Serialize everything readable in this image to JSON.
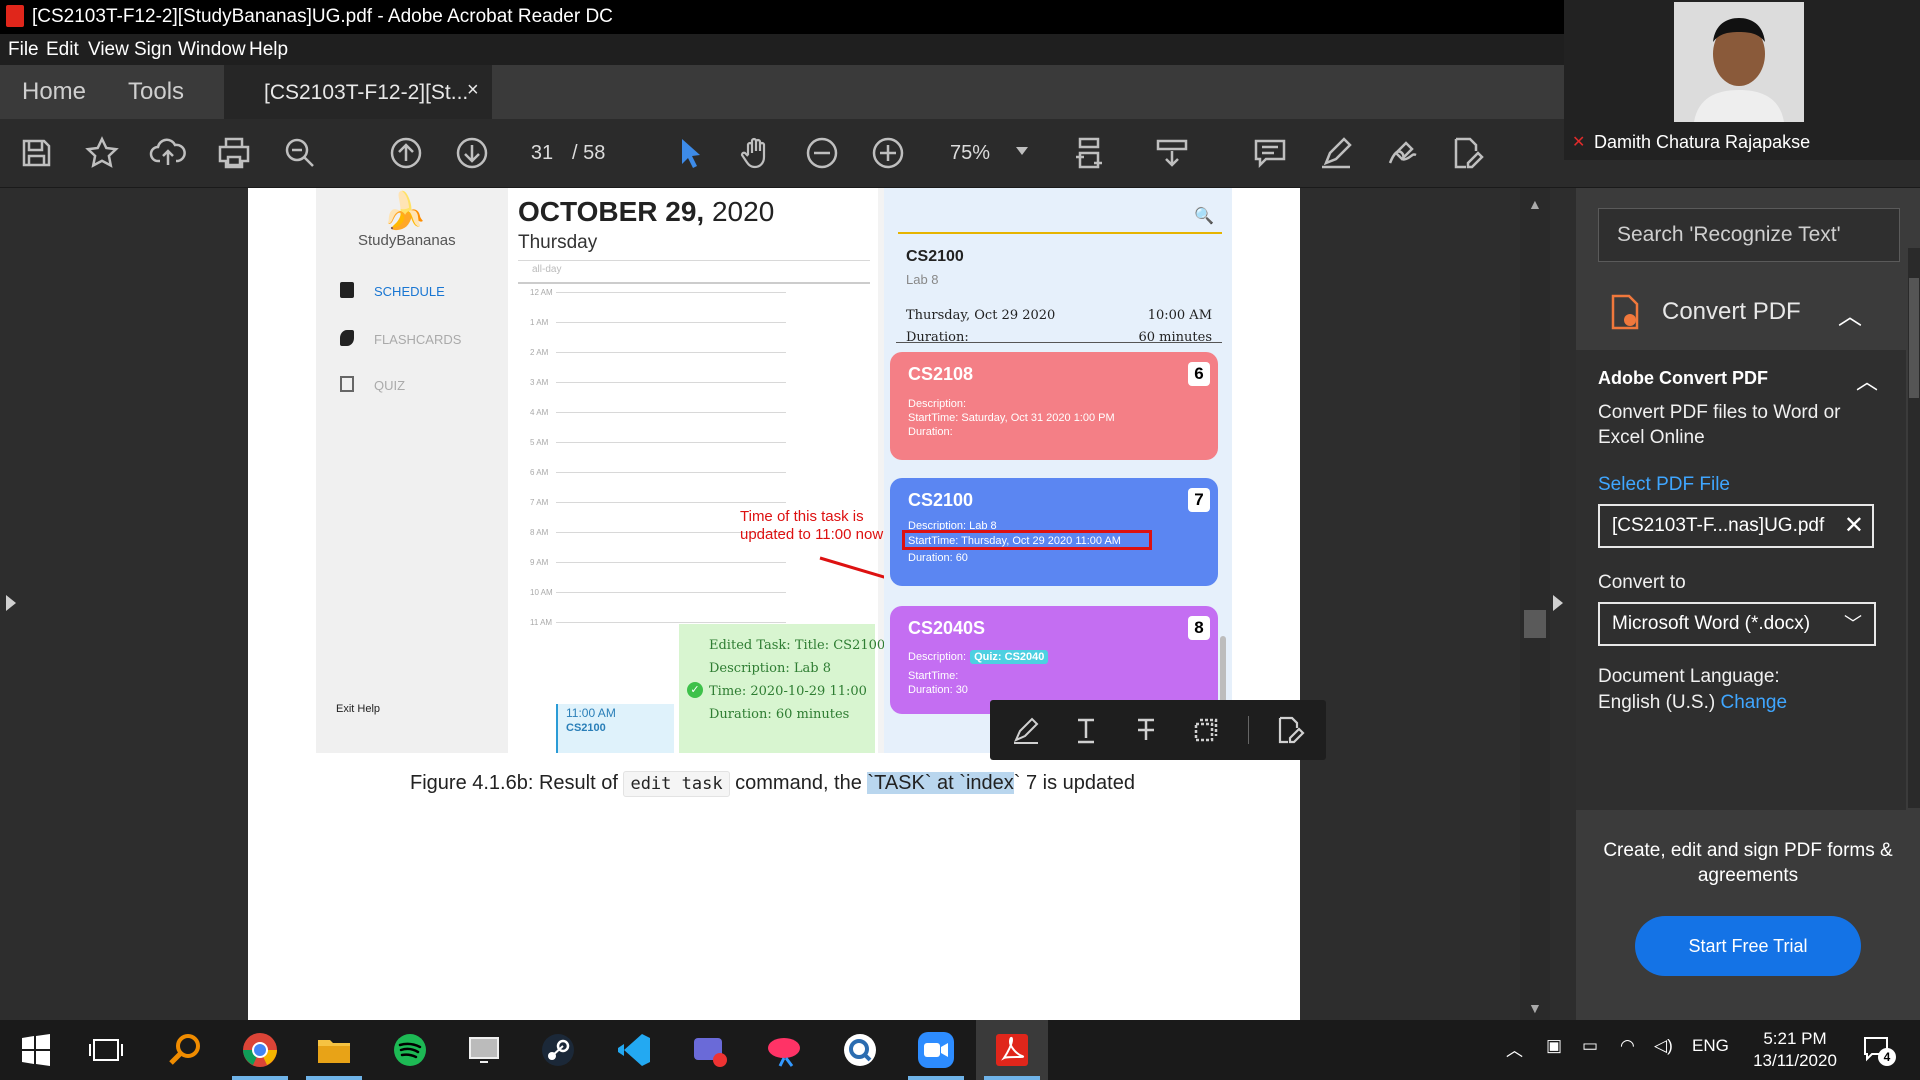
{
  "window": {
    "title": "[CS2103T-F12-2][StudyBananas]UG.pdf - Adobe Acrobat Reader DC"
  },
  "menu": [
    "File",
    "Edit",
    "View",
    "Sign",
    "Window",
    "Help"
  ],
  "tabs": {
    "home": "Home",
    "tools": "Tools",
    "doc": "[CS2103T-F12-2][St...",
    "close": "×"
  },
  "toolbar": {
    "page_current": "31",
    "page_total": "/  58",
    "zoom": "75%"
  },
  "screenshot": {
    "brand": "StudyBananas",
    "nav": [
      "SCHEDULE",
      "FLASHCARDS",
      "QUIZ"
    ],
    "footer": "Exit   Help",
    "cal_date_bold": "OCTOBER 29,",
    "cal_date_year": " 2020",
    "cal_day": "Thursday",
    "allday": "all-day",
    "hours": [
      "12 AM",
      "1 AM",
      "2 AM",
      "3 AM",
      "4 AM",
      "5 AM",
      "6 AM",
      "7 AM",
      "8 AM",
      "9 AM",
      "10 AM",
      "11 AM"
    ],
    "event_time": "11:00 AM",
    "event_code": "CS2100",
    "annotation": "Time of this task is updated to 11:00 now",
    "toast": [
      "Edited Task: Title: CS2100",
      "Description: Lab 8",
      "Time: 2020-10-29 11:00",
      "Duration: 60 minutes"
    ],
    "detail": {
      "code": "CS2100",
      "sub": "Lab 8",
      "date": "Thursday, Oct 29 2020",
      "time": "10:00 AM",
      "dur_label": "Duration:",
      "dur_val": "60 minutes"
    },
    "cards": [
      {
        "code": "CS2108",
        "num": "6",
        "desc": "Description:",
        "start": "StartTime:  Saturday, Oct 31 2020   1:00 PM",
        "dur": "Duration:"
      },
      {
        "code": "CS2100",
        "num": "7",
        "desc": "Description:  Lab 8",
        "start": "StartTime:  Thursday, Oct 29 2020   11:00 AM",
        "dur": "Duration:  60"
      },
      {
        "code": "CS2040S",
        "num": "8",
        "desc": "Description:",
        "tag": "Quiz: CS2040",
        "start": "StartTime:",
        "dur": "Duration:  30"
      }
    ]
  },
  "caption": {
    "pre": "Figure 4.1.6b: Result of ",
    "code": "edit task",
    "mid": " command, the ",
    "sel": "`TASK` at `index",
    "post": "` 7 is updated"
  },
  "right_pane": {
    "search_placeholder": "Search 'Recognize Text'",
    "convert_title": "Convert PDF",
    "panel_heading": "Adobe Convert PDF",
    "panel_desc": "Convert PDF files to Word or Excel Online",
    "select_link": "Select PDF File",
    "file_name": "[CS2103T-F...nas]UG.pdf",
    "convert_to": "Convert to",
    "format": "Microsoft Word (*.docx)",
    "doc_lang_label": "Document Language:",
    "doc_lang": "English (U.S.)",
    "change": "Change",
    "promo": "Create, edit and sign PDF forms & agreements",
    "trial": "Start Free Trial"
  },
  "video": {
    "name": "Damith Chatura Rajapakse"
  },
  "taskbar": {
    "lang": "ENG",
    "time": "5:21 PM",
    "date": "13/11/2020",
    "notifications": "4"
  }
}
